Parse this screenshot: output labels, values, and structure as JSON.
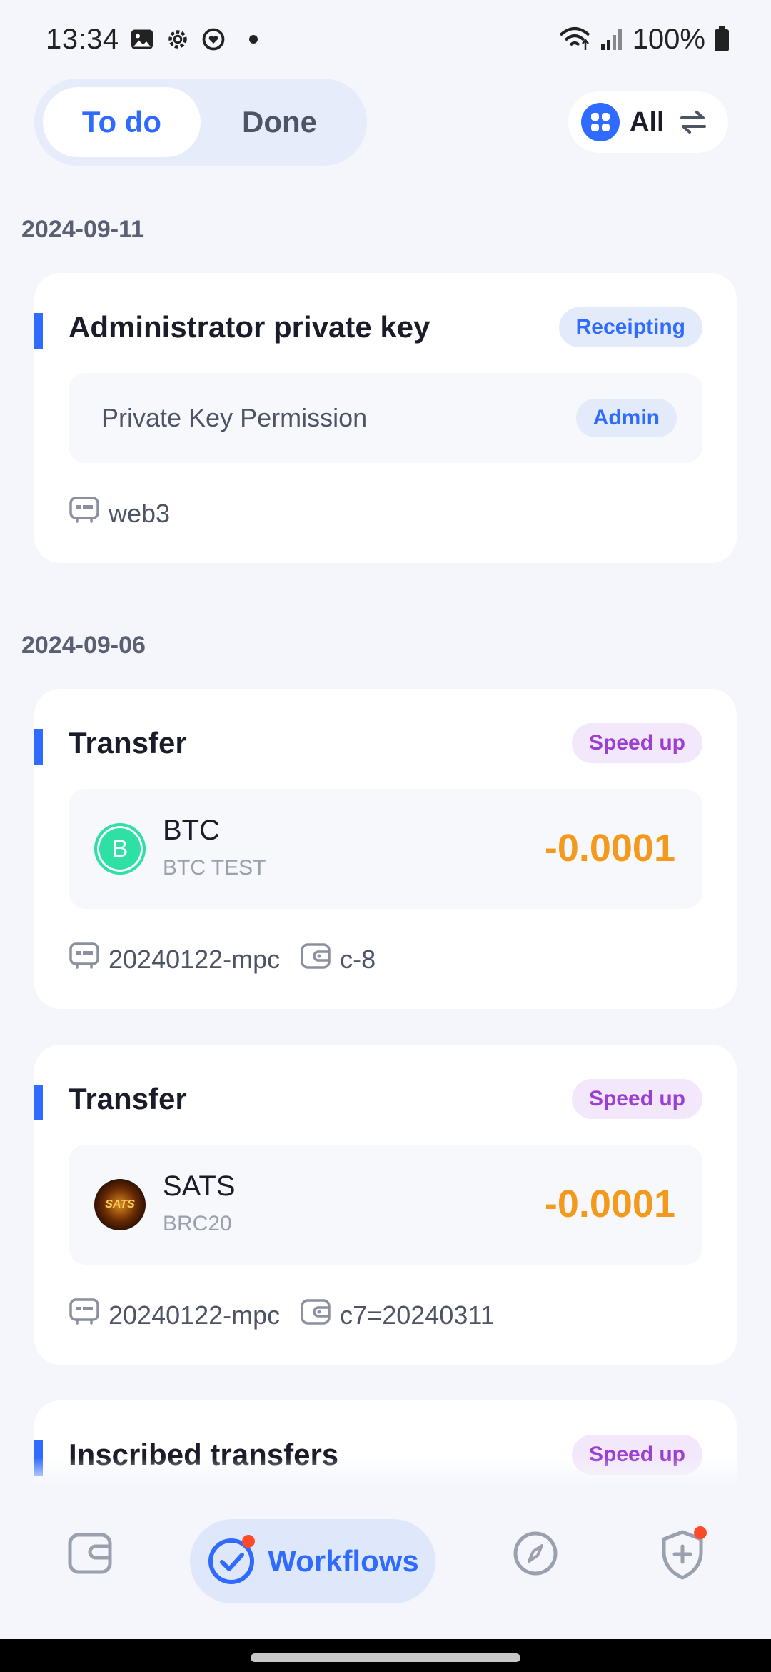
{
  "status_bar": {
    "time": "13:34",
    "battery": "100%"
  },
  "tabs": {
    "todo": "To do",
    "done": "Done",
    "active": "To do"
  },
  "filter": {
    "label": "All"
  },
  "groups": [
    {
      "date": "2024-09-11",
      "cards": [
        {
          "title": "Administrator private key",
          "status": "Receipting",
          "detail_label": "Private Key Permission",
          "detail_role": "Admin",
          "meta": [
            "web3"
          ]
        }
      ]
    },
    {
      "date": "2024-09-06",
      "cards": [
        {
          "title": "Transfer",
          "status": "Speed up",
          "token": {
            "symbol": "BTC",
            "network": "BTC TEST",
            "icon_letter": "B",
            "amount": "-0.0001"
          },
          "meta": [
            "20240122-mpc",
            "c-8"
          ]
        },
        {
          "title": "Transfer",
          "status": "Speed up",
          "token": {
            "symbol": "SATS",
            "network": "BRC20",
            "icon_letter": "SATS",
            "amount": "-0.0001"
          },
          "meta": [
            "20240122-mpc",
            "c7=20240311"
          ]
        },
        {
          "title": "Inscribed transfers",
          "status": "Speed up"
        }
      ]
    }
  ],
  "bottom_nav": {
    "wallet": "wallet-icon",
    "workflows": "Workflows",
    "discover": "compass-icon",
    "security": "shield-plus-icon"
  },
  "colors": {
    "accent": "#2f6bff",
    "amount": "#f39a1e",
    "speed_up": "#9a3fd1",
    "badge": "#ff4a2a"
  }
}
